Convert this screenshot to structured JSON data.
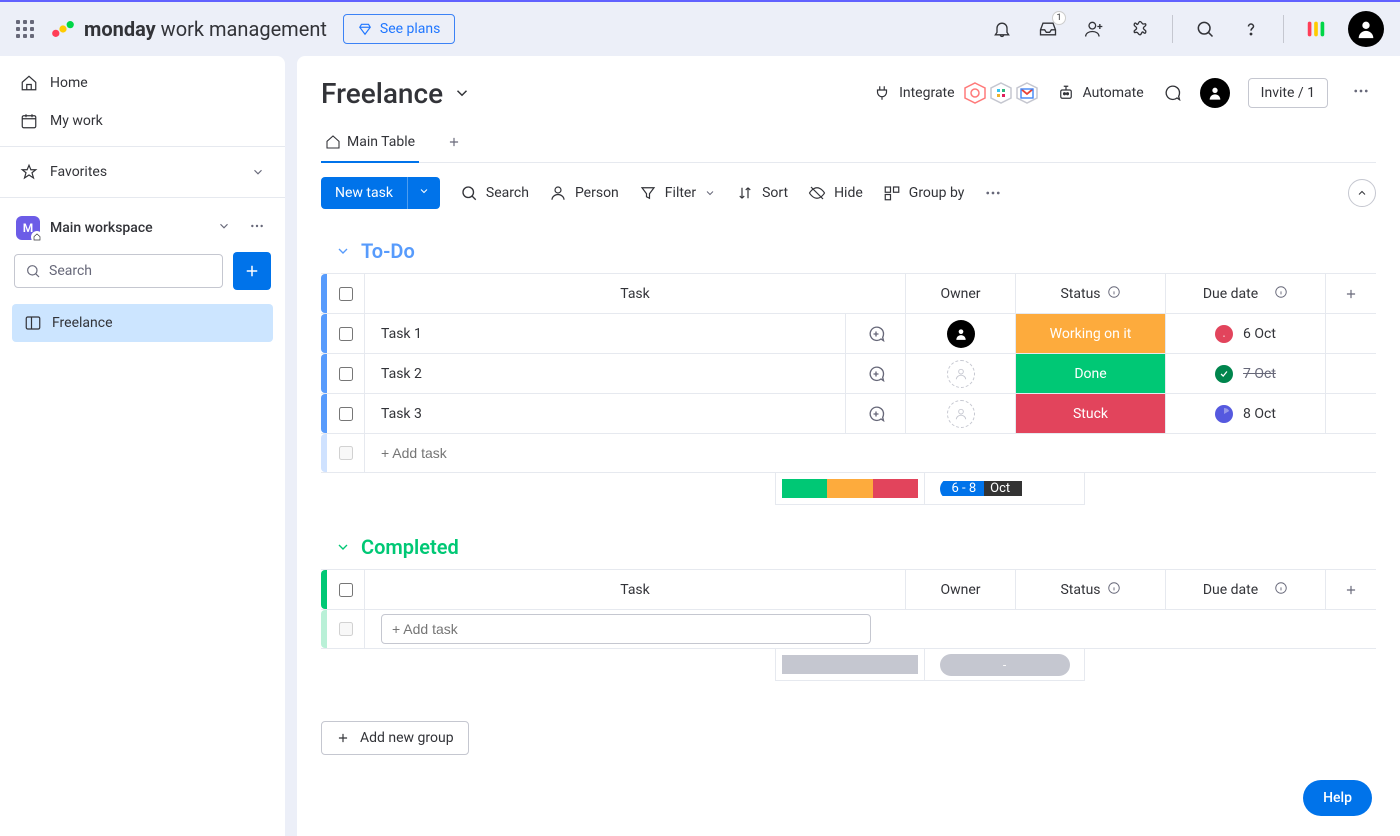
{
  "topbar": {
    "brand_bold": "monday",
    "brand_rest": " work management",
    "see_plans": "See plans",
    "inbox_badge": "1"
  },
  "sidebar": {
    "home": "Home",
    "my_work": "My work",
    "favorites": "Favorites",
    "workspace_name": "Main workspace",
    "workspace_initial": "M",
    "search_placeholder": "Search",
    "board_name": "Freelance"
  },
  "board": {
    "title": "Freelance",
    "integrate": "Integrate",
    "automate": "Automate",
    "invite": "Invite / 1",
    "tab_main": "Main Table",
    "new_task": "New task",
    "search": "Search",
    "person": "Person",
    "filter": "Filter",
    "sort": "Sort",
    "hide": "Hide",
    "group_by": "Group by",
    "add_group": "Add new group"
  },
  "columns": {
    "task": "Task",
    "owner": "Owner",
    "status": "Status",
    "due": "Due date"
  },
  "groups": {
    "todo": {
      "name": "To-Do",
      "rows": [
        {
          "task": "Task 1",
          "status": "Working on it",
          "status_class": "working",
          "due": "6 Oct",
          "due_state": "alert",
          "owner": "assigned"
        },
        {
          "task": "Task 2",
          "status": "Done",
          "status_class": "done",
          "due": "7 Oct",
          "due_state": "check",
          "owner": "empty",
          "strike": true
        },
        {
          "task": "Task 3",
          "status": "Stuck",
          "status_class": "stuck",
          "due": "8 Oct",
          "due_state": "clock",
          "owner": "empty"
        }
      ],
      "add_task": "+ Add task",
      "summary_due_a": "6 - 8",
      "summary_due_b": " Oct"
    },
    "completed": {
      "name": "Completed",
      "add_task": "+ Add task",
      "summary_placeholder": "-"
    }
  },
  "help": "Help"
}
